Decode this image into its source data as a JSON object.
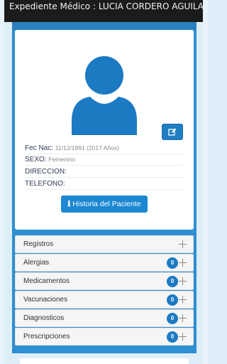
{
  "titlebar": {
    "text": "Expediente Médico : LUCIA CORDERO AGUILAR"
  },
  "profile": {
    "avatar_icon": "user-silhouette-icon",
    "edit_icon": "edit-icon",
    "fields": [
      {
        "label": "Fec Nac:",
        "value": "11/12/1991 (2017 Años)"
      },
      {
        "label": "SEXO:",
        "value": "Femenino"
      },
      {
        "label": "DIRECCION:",
        "value": ""
      },
      {
        "label": "TELEFONO:",
        "value": ""
      }
    ],
    "history_button": {
      "icon": "info-icon",
      "label": "Historia del Paciente"
    }
  },
  "sections": [
    {
      "label": "Registros",
      "count": null
    },
    {
      "label": "Alergias",
      "count": "0"
    },
    {
      "label": "Medicamentos",
      "count": "0"
    },
    {
      "label": "Vacunaciones",
      "count": "0"
    },
    {
      "label": "Diagnosticos",
      "count": "0"
    },
    {
      "label": "Prescripciones",
      "count": "0"
    }
  ],
  "colors": {
    "panel_blue": "#2e8fd1",
    "accent_blue": "#1c87d2",
    "avatar_blue": "#1c7ac3",
    "titlebar_bg": "#1b1b1b"
  }
}
